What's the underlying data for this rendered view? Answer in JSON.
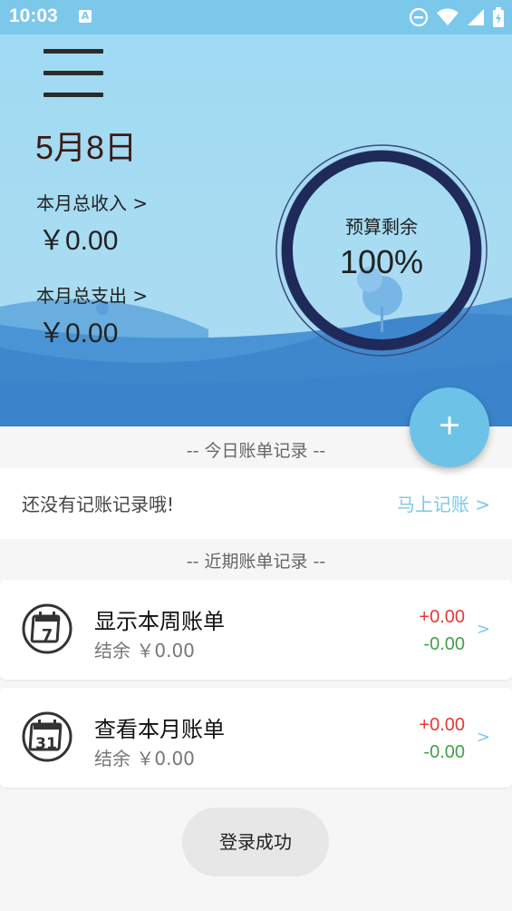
{
  "status_bar": {
    "time": "10:03",
    "notification_icon": "a-icon",
    "icons": [
      "do-not-disturb-icon",
      "wifi-icon",
      "signal-icon",
      "battery-icon"
    ]
  },
  "header": {
    "menu_icon": "hamburger-menu-icon",
    "date": "5月8日",
    "income_label": "本月总收入 >",
    "income_value": "￥0.00",
    "expense_label": "本月总支出 >",
    "expense_value": "￥0.00",
    "budget_label": "预算剩余",
    "budget_value": "100%",
    "budget_fraction": 1.0
  },
  "fab": {
    "label": "+"
  },
  "today": {
    "section_title": "-- 今日账单记录 --",
    "empty_text": "还没有记账记录哦!",
    "add_link": "马上记账 >"
  },
  "recent": {
    "section_title": "-- 近期账单记录 --",
    "cards": [
      {
        "icon": "calendar-week-icon",
        "day": "7",
        "title": "显示本周账单",
        "balance": "结余 ￥0.00",
        "income": "+0.00",
        "expense": "-0.00",
        "chevron": ">"
      },
      {
        "icon": "calendar-month-icon",
        "day": "31",
        "title": "查看本月账单",
        "balance": "结余 ￥0.00",
        "income": "+0.00",
        "expense": "-0.00",
        "chevron": ">"
      }
    ]
  },
  "toast": {
    "text": "登录成功"
  },
  "colors": {
    "accent": "#6cc3e7",
    "income": "#e53935",
    "expense": "#43a047",
    "ring": "#1f2a5a"
  }
}
